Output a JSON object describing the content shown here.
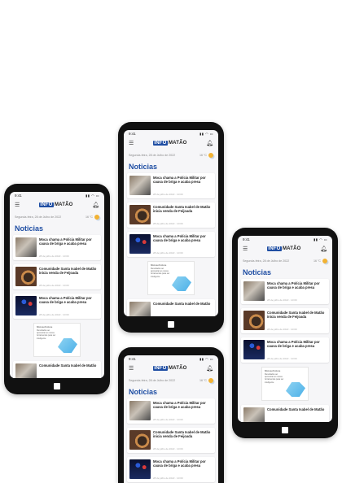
{
  "app": {
    "time": "9:41",
    "status_icons": "▮▮ ◠ ▭",
    "logo_part1": "INFO",
    "logo_part2": "MATÃO",
    "date": "Segunda-feira, 28 de Julho de 2022",
    "temperature": "16 °C",
    "section_title": "Noticias",
    "articles": [
      {
        "title": "Moca chama a Polícia Militar por causa de briga e acaba presa",
        "meta": "28 de julho de 2022 · 10:00"
      },
      {
        "title": "Comunidade Santa Isabel de Matão inicia venda de Feijoada",
        "meta": "28 de julho de 2022 · 10:00"
      },
      {
        "title": "Moca chama a Polícia Militar por causa de briga e acaba presa",
        "meta": "28 de julho de 2022 · 10:00"
      },
      {
        "title": "Comunidade Santa Isabel de Matão",
        "meta": ""
      }
    ],
    "ad": {
      "brand": "Microsoft Azure",
      "text": "Resultados ao aproveitar as novas ferramentas para ser inteligente"
    }
  },
  "colors": {
    "accent": "#1f4ea3",
    "phone_frame": "#111111",
    "screen_bg": "#f6f6f8"
  },
  "icons": {
    "menu": "menu-icon",
    "bell": "bell-icon",
    "weather": "partly-cloudy-icon"
  }
}
